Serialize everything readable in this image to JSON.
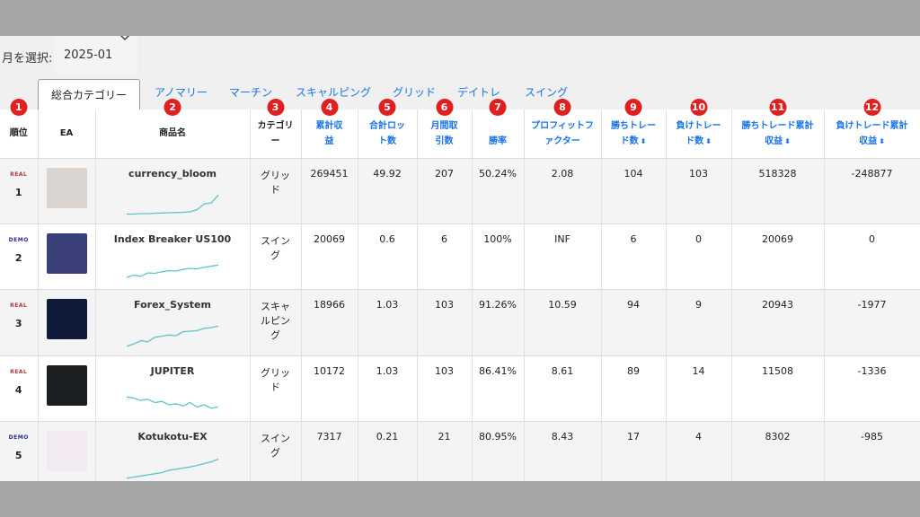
{
  "month": {
    "label": "月を選択:",
    "value": "2025-01"
  },
  "tabs": [
    "総合カテゴリー",
    "アノマリー",
    "マーチン",
    "スキャルピング",
    "グリッド",
    "デイトレ",
    "スイング"
  ],
  "columns": [
    {
      "l1": "順位",
      "l2": "",
      "badge": "1"
    },
    {
      "l1": "EA",
      "l2": "",
      "badge": ""
    },
    {
      "l1": "商品名",
      "l2": "",
      "badge": "2"
    },
    {
      "l1": "カテゴリ",
      "l2": "ー",
      "badge": "3"
    },
    {
      "l1": "累計収",
      "l2": "益",
      "badge": "4"
    },
    {
      "l1": "合計ロッ",
      "l2": "ト数",
      "badge": "5"
    },
    {
      "l1": "月間取",
      "l2": "引数",
      "badge": "6"
    },
    {
      "l1": "",
      "l2": "勝率",
      "badge": "7"
    },
    {
      "l1": "プロフィットフ",
      "l2": "ァクター",
      "badge": "8"
    },
    {
      "l1": "勝ちトレー",
      "l2": "ド数",
      "badge": "9"
    },
    {
      "l1": "負けトレー",
      "l2": "ド数",
      "badge": "10"
    },
    {
      "l1": "勝ちトレード累計",
      "l2": "収益",
      "badge": "11"
    },
    {
      "l1": "負けトレード累計",
      "l2": "収益",
      "badge": "12"
    }
  ],
  "sort_glyph": "⬍",
  "rows": [
    {
      "account": "REAL",
      "rank": "1",
      "name": "currency_bloom",
      "category": "グリッド",
      "profit": "269451",
      "lots": "49.92",
      "trades": "207",
      "winrate": "50.24%",
      "pf": "2.08",
      "wins": "104",
      "losses": "103",
      "win_profit": "518328",
      "loss_profit": "-248877",
      "thumb_color": "#d9d4cf",
      "spark": [
        0.1,
        0.1,
        0.12,
        0.12,
        0.14,
        0.15,
        0.16,
        0.17,
        0.18,
        0.2,
        0.3,
        0.55,
        0.6,
        0.95
      ]
    },
    {
      "account": "DEMO",
      "rank": "2",
      "name": "Index Breaker US100",
      "category": "スイング",
      "profit": "20069",
      "lots": "0.6",
      "trades": "6",
      "winrate": "100%",
      "pf": "INF",
      "wins": "6",
      "losses": "0",
      "win_profit": "20069",
      "loss_profit": "0",
      "thumb_color": "#3a3f7a",
      "spark": [
        0.2,
        0.3,
        0.25,
        0.4,
        0.38,
        0.45,
        0.5,
        0.48,
        0.55,
        0.6,
        0.58,
        0.65,
        0.7,
        0.75
      ]
    },
    {
      "account": "REAL",
      "rank": "3",
      "name": "Forex_System",
      "category": "スキャルピング",
      "profit": "18966",
      "lots": "1.03",
      "trades": "103",
      "winrate": "91.26%",
      "pf": "10.59",
      "wins": "94",
      "losses": "9",
      "win_profit": "20943",
      "loss_profit": "-1977",
      "thumb_color": "#101a3a",
      "spark": [
        0.05,
        0.15,
        0.3,
        0.25,
        0.45,
        0.5,
        0.55,
        0.52,
        0.7,
        0.72,
        0.75,
        0.85,
        0.88,
        0.95
      ]
    },
    {
      "account": "REAL",
      "rank": "4",
      "name": "JUPITER",
      "category": "グリッド",
      "profit": "10172",
      "lots": "1.03",
      "trades": "103",
      "winrate": "86.41%",
      "pf": "8.61",
      "wins": "89",
      "losses": "14",
      "win_profit": "11508",
      "loss_profit": "-1336",
      "thumb_color": "#1c1f22",
      "spark": [
        0.75,
        0.7,
        0.6,
        0.65,
        0.5,
        0.55,
        0.4,
        0.45,
        0.35,
        0.5,
        0.3,
        0.4,
        0.25,
        0.3
      ]
    },
    {
      "account": "DEMO",
      "rank": "5",
      "name": "Kotukotu-EX",
      "category": "スイング",
      "profit": "7317",
      "lots": "0.21",
      "trades": "21",
      "winrate": "80.95%",
      "pf": "8.43",
      "wins": "17",
      "losses": "4",
      "win_profit": "8302",
      "loss_profit": "-985",
      "thumb_color": "#f3e9f0",
      "spark": [
        0.05,
        0.1,
        0.15,
        0.2,
        0.25,
        0.3,
        0.4,
        0.45,
        0.5,
        0.55,
        0.62,
        0.7,
        0.78,
        0.9
      ]
    }
  ],
  "colors": {
    "link": "#1a73e8",
    "badge": "#e02020",
    "spark": "#5bc7c4",
    "real": "#b03c3c",
    "demo": "#2b2d8a"
  }
}
